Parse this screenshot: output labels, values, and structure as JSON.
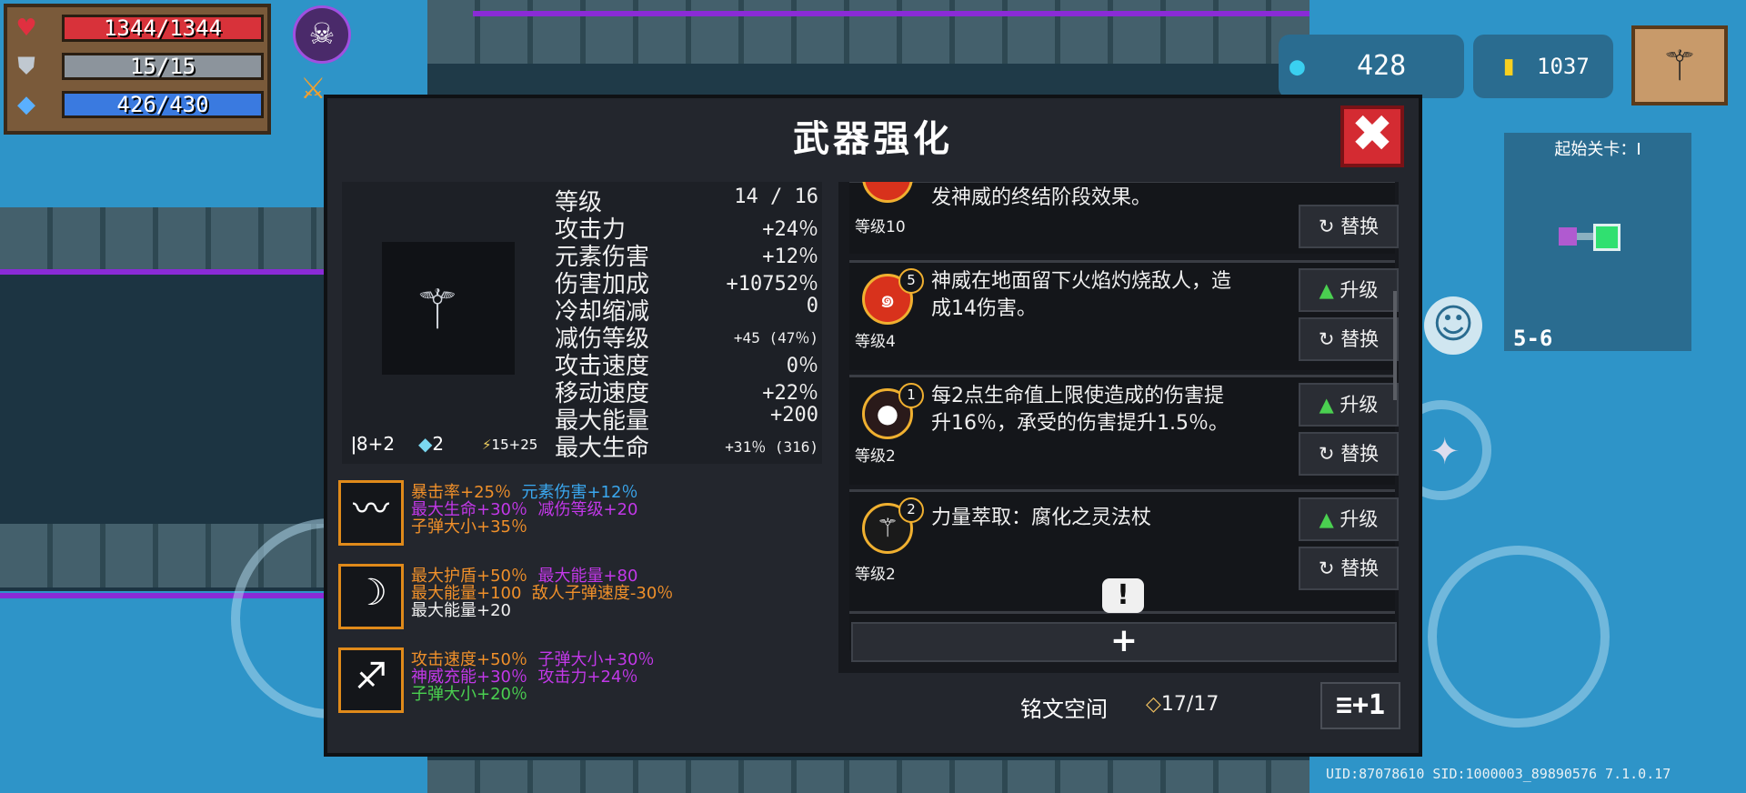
{
  "hud": {
    "hp": "1344/1344",
    "armor": "15/15",
    "mana": "426/430",
    "gems": "428",
    "coins": "1037"
  },
  "panel": {
    "title": "武器强化",
    "close": "✖"
  },
  "weapon": {
    "ammo": "8+2",
    "crystal": "2",
    "bonus": "15+25"
  },
  "stats": [
    {
      "label": "等级",
      "value": "14 / 16"
    },
    {
      "label": "攻击力",
      "value": "+24％"
    },
    {
      "label": "元素伤害",
      "value": "+12％"
    },
    {
      "label": "伤害加成",
      "value": "+10752％"
    },
    {
      "label": "冷却缩减",
      "value": "0"
    },
    {
      "label": "减伤等级",
      "value": "+45 (47％)"
    },
    {
      "label": "攻击速度",
      "value": "0％"
    },
    {
      "label": "移动速度",
      "value": "+22％"
    },
    {
      "label": "最大能量",
      "value": "+200"
    },
    {
      "label": "最大生命",
      "value": "+31％ (316)"
    }
  ],
  "mods": [
    {
      "line1a": "暴击率+25％",
      "line1b": "元素伤害+12％",
      "line2a": "最大生命+30％",
      "line2b": "减伤等级+20",
      "line3": "子弹大小+35％"
    },
    {
      "line1a": "最大护盾+50％",
      "line1b": "最大能量+80",
      "line2a": "最大能量+100",
      "line2b": "敌人子弹速度-30％",
      "line3": "最大能量+20"
    },
    {
      "line1a": "攻击速度+50％",
      "line1b": "子弹大小+30％",
      "line2a": "神威充能+30％",
      "line2b": "攻击力+24％",
      "line3": "子弹大小+20％"
    }
  ],
  "cards": [
    {
      "desc": "发神威的终结阶段效果。",
      "level": "等级10",
      "btn2": "替换"
    },
    {
      "badge": "5",
      "desc": "神威在地面留下火焰灼烧敌人，造成14伤害。",
      "level": "等级4",
      "btn1": "升级",
      "btn2": "替换"
    },
    {
      "badge": "1",
      "desc": "每2点生命值上限使造成的伤害提升16％，承受的伤害提升1.5％。",
      "level": "等级2",
      "btn1": "升级",
      "btn2": "替换"
    },
    {
      "badge": "2",
      "desc": "力量萃取：腐化之灵法杖",
      "level": "等级2",
      "btn1": "升级",
      "btn2": "替换"
    }
  ],
  "footer": {
    "add": "+",
    "bang": "!",
    "rune_space_label": "铭文空间",
    "rune_space_value": "17/17",
    "plus_one": "≡+1"
  },
  "minimap": {
    "start_level": "起始关卡：Ⅰ",
    "stage": "5-6"
  },
  "uid_line": "UID:87078610 SID:1000003_89890576 7.1.0.17",
  "colors": {
    "hp": "#d8323a",
    "mana": "#3a7ae0",
    "accent_orange": "#f0902a",
    "close_red": "#d42b32"
  }
}
